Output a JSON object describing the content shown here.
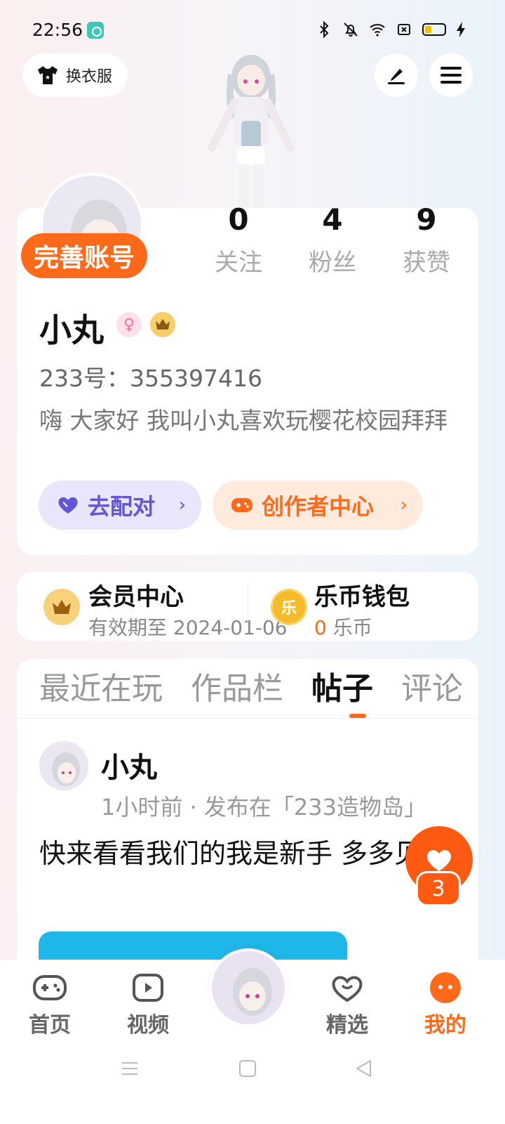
{
  "status_bar": {
    "time": "22:56"
  },
  "header": {
    "outfit_button_label": "换衣服"
  },
  "profile": {
    "complete_account_label": "完善账号",
    "stats": [
      {
        "value": "0",
        "label": "关注"
      },
      {
        "value": "4",
        "label": "粉丝"
      },
      {
        "value": "9",
        "label": "获赞"
      }
    ],
    "username": "小丸",
    "gender_symbol": "♀",
    "account_id": "233号：355397416",
    "bio": "嗨 大家好 我叫小丸喜欢玩樱花校园拜拜",
    "match_button": "去配对",
    "creator_button": "创作者中心",
    "chevron": "›"
  },
  "member": {
    "title": "会员中心",
    "expiry": "有效期至 2024-01-06"
  },
  "wallet": {
    "title": "乐币钱包",
    "coin_glyph": "乐",
    "balance": "0",
    "unit": "乐币"
  },
  "tabs": [
    {
      "label": "最近在玩",
      "active": false
    },
    {
      "label": "作品栏",
      "active": false
    },
    {
      "label": "帖子",
      "active": true
    },
    {
      "label": "评论",
      "active": false
    }
  ],
  "post": {
    "author": "小丸",
    "meta": "1小时前 · 发布在「233造物岛」",
    "text": "快来看看我们的我是新手 多多见谅"
  },
  "like": {
    "count": "3"
  },
  "bottom_nav": [
    {
      "label": "首页",
      "icon": "gamepad-icon",
      "active": false
    },
    {
      "label": "视频",
      "icon": "video-play-icon",
      "active": false
    },
    {
      "label": "精选",
      "icon": "heart-chat-icon",
      "active": false
    },
    {
      "label": "我的",
      "icon": "face-icon",
      "active": true
    }
  ],
  "colors": {
    "accent": "#ff6a1a",
    "match_purple": "#6255d8",
    "match_bg": "#e9e6fc",
    "creator_bg": "#ffeade"
  }
}
